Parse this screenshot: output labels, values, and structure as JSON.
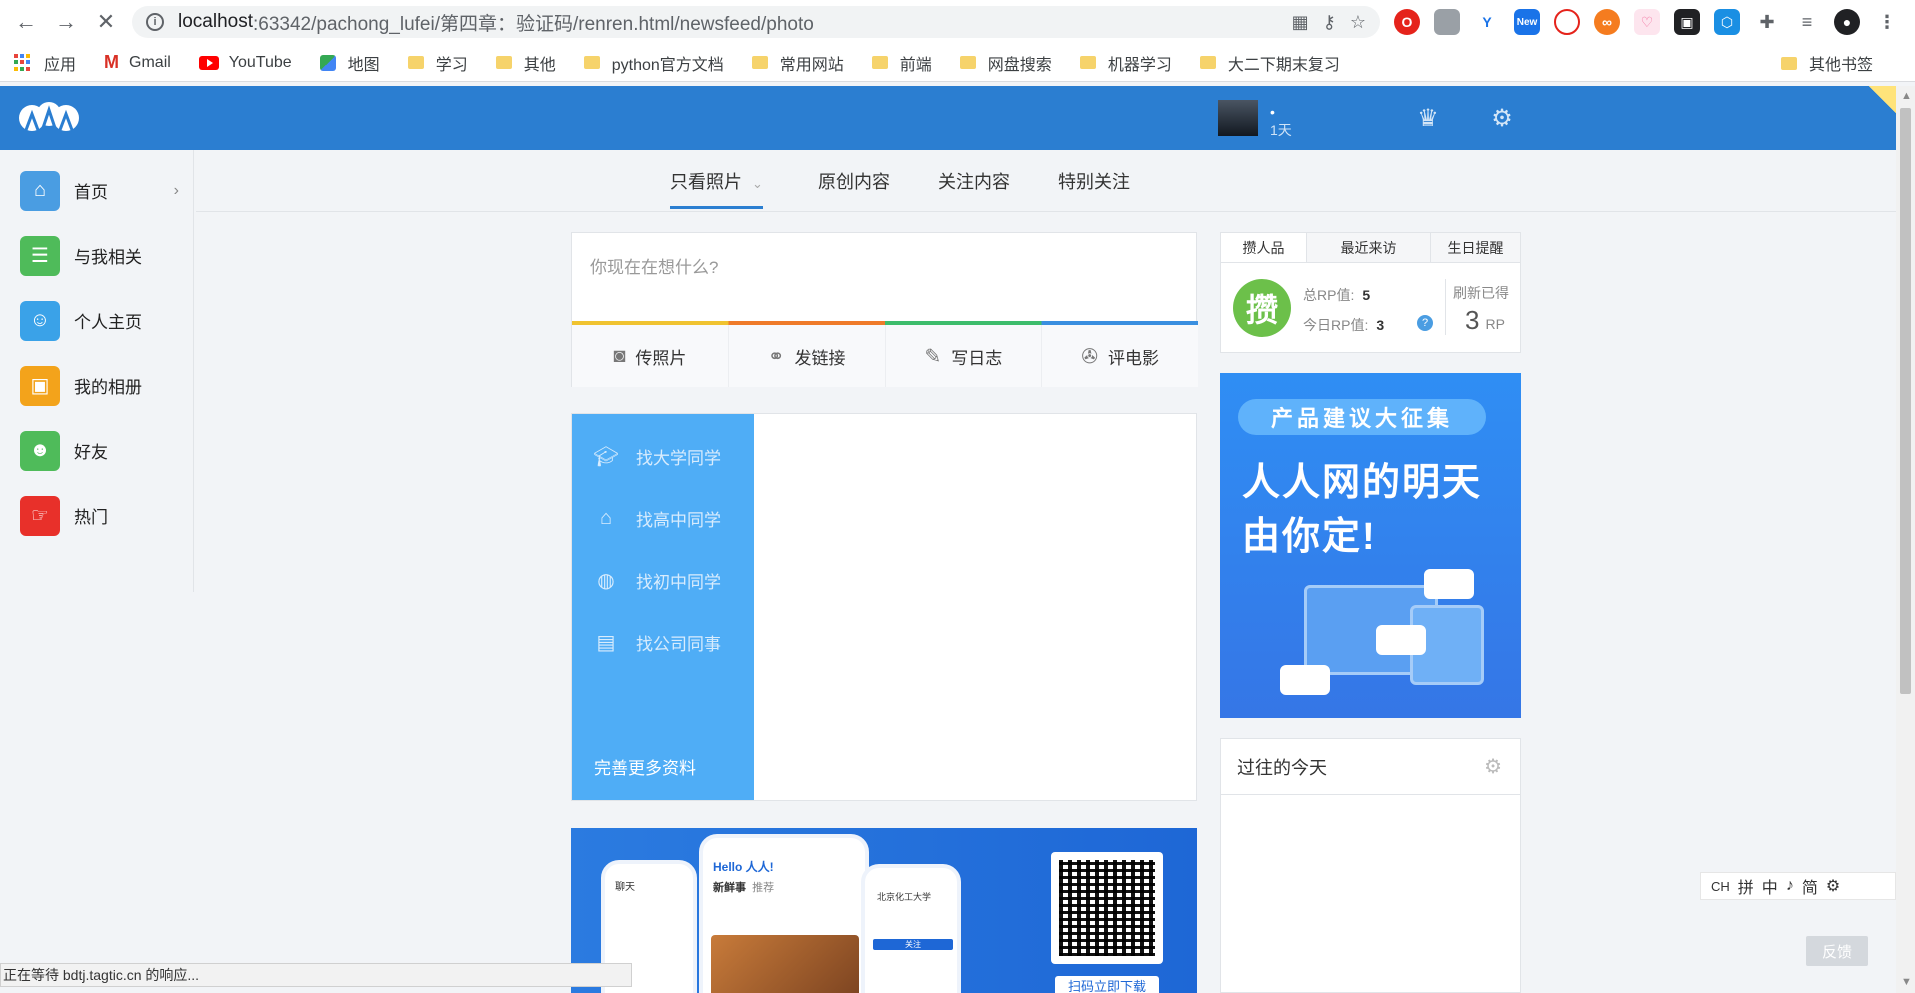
{
  "browser": {
    "url_host": "localhost",
    "url_rest": ":63342/pachong_lufei/第四章：验证码/renren.html/newsfeed/photo",
    "extension_new_badge": "New",
    "bookmarks": [
      "应用",
      "Gmail",
      "YouTube",
      "地图",
      "学习",
      "其他",
      "python官方文档",
      "常用网站",
      "前端",
      "网盘搜索",
      "机器学习",
      "大二下期末复习"
    ],
    "other_bookmarks": "其他书签",
    "status_text": "正在等待 bdtj.tagtic.cn 的响应..."
  },
  "header": {
    "user_dot": "•",
    "user_days": "1天",
    "accent": "#2b7ed1"
  },
  "sidebar": {
    "items": [
      {
        "label": "首页",
        "icon": "home-icon",
        "color": "#4a9de2"
      },
      {
        "label": "与我相关",
        "icon": "user-list-icon",
        "color": "#4fbb5a"
      },
      {
        "label": "个人主页",
        "icon": "person-icon",
        "color": "#3aa2e8"
      },
      {
        "label": "我的相册",
        "icon": "album-icon",
        "color": "#f3a31b"
      },
      {
        "label": "好友",
        "icon": "friends-icon",
        "color": "#4fbb5a"
      },
      {
        "label": "热门",
        "icon": "hot-icon",
        "color": "#e8302a"
      }
    ]
  },
  "filter_tabs": [
    "只看照片",
    "原创内容",
    "关注内容",
    "特别关注"
  ],
  "composer": {
    "placeholder": "你现在在想什么?",
    "actions": [
      "传照片",
      "发链接",
      "写日志",
      "评电影"
    ]
  },
  "finder": {
    "items": [
      "找大学同学",
      "找高中同学",
      "找初中同学",
      "找公司同事"
    ],
    "more": "完善更多资料"
  },
  "app_banner": {
    "greeting": "Hello 人人!",
    "feed": "新鲜事",
    "recommend": "推荐",
    "chat": "聊天",
    "school": "北京化工大学",
    "follow": "关注",
    "qr_label": "扫码立即下载"
  },
  "rp": {
    "tabs": [
      "攒人品",
      "最近来访",
      "生日提醒"
    ],
    "badge": "攒",
    "total_label": "总RP值:",
    "total_value": "5",
    "today_label": "今日RP值:",
    "today_value": "3",
    "help": "?",
    "refresh_label": "刷新已得",
    "refresh_value": "3",
    "refresh_unit": "RP"
  },
  "promo": {
    "tag": "产品建议大征集",
    "line1": "人人网的明天",
    "line2": "由你定!"
  },
  "history": {
    "title": "过往的今天"
  },
  "ime": [
    "CH",
    "拼",
    "中",
    "♪",
    "简",
    "⚙"
  ],
  "feedback": "反馈"
}
